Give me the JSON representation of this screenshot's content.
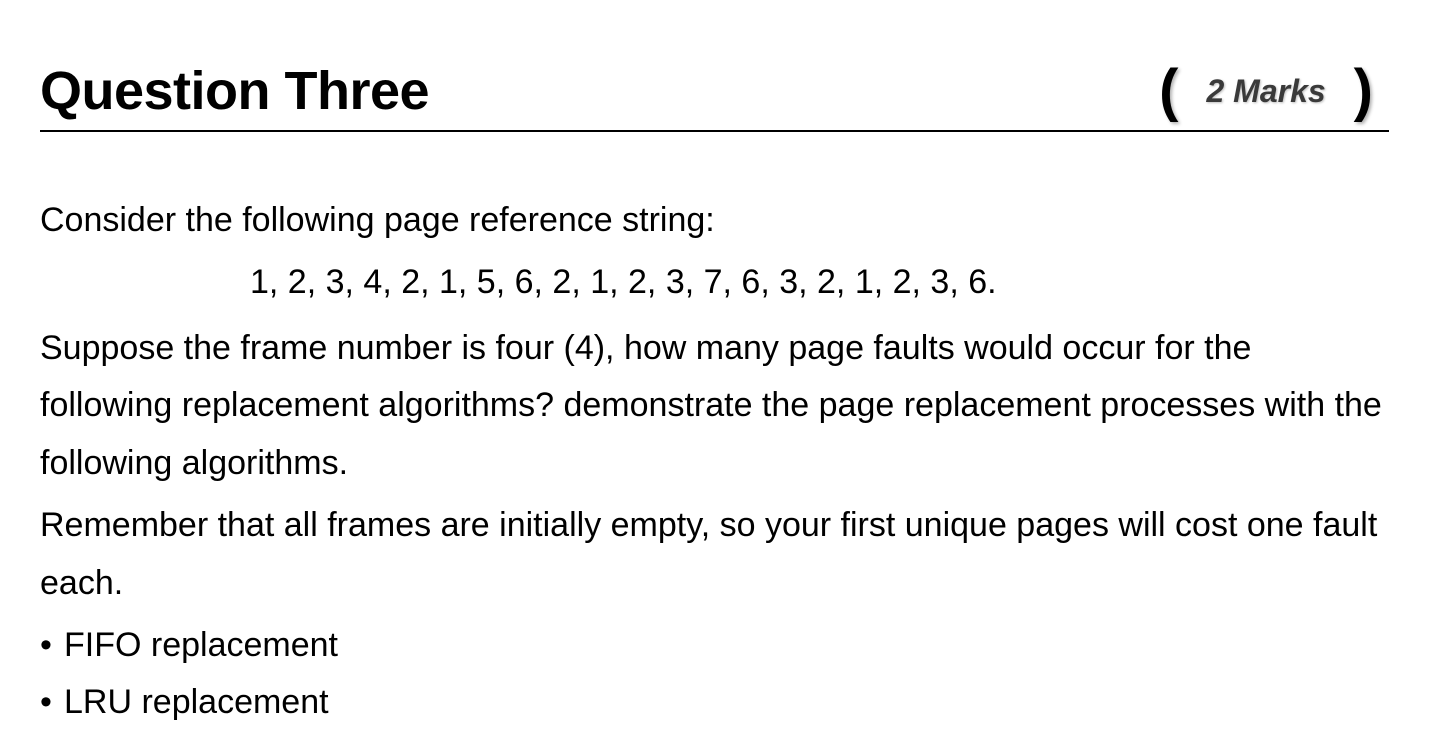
{
  "header": {
    "title": "Question Three",
    "marks": "2 Marks"
  },
  "content": {
    "intro": "Consider the following page reference string:",
    "reference_string": "1, 2, 3, 4, 2, 1, 5, 6, 2, 1, 2, 3, 7, 6, 3, 2, 1, 2, 3, 6.",
    "paragraph1": "Suppose the frame number is four (4), how many page faults would occur for the following replacement algorithms? demonstrate the page replacement processes with the following algorithms.",
    "paragraph2": "Remember that all frames are initially empty, so your first unique pages will cost one fault each.",
    "bullets": [
      "FIFO replacement",
      "LRU replacement"
    ]
  }
}
